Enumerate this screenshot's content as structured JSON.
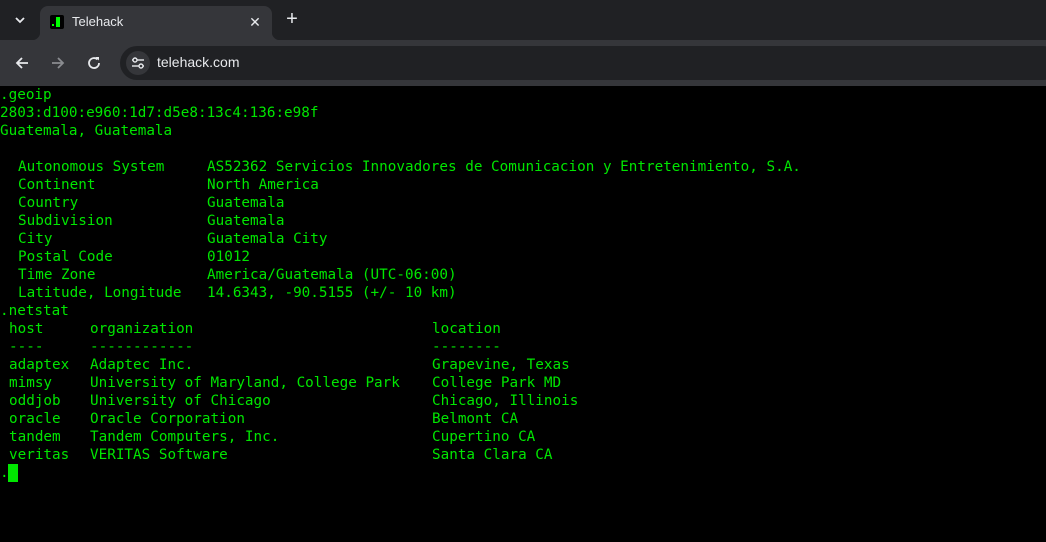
{
  "browser": {
    "tab_title": "Telehack",
    "tab_close": "✕",
    "new_tab": "+",
    "url": "telehack.com"
  },
  "terminal": {
    "geoip_cmd": ".geoip",
    "ip_address": "2803:d100:e960:1d7:d5e8:13c4:136:e98f",
    "place": "Guatemala, Guatemala",
    "geo_fields": [
      {
        "label": "Autonomous System",
        "value": "AS52362 Servicios Innovadores de Comunicacion y Entretenimiento, S.A."
      },
      {
        "label": "Continent",
        "value": "North America"
      },
      {
        "label": "Country",
        "value": "Guatemala"
      },
      {
        "label": "Subdivision",
        "value": "Guatemala"
      },
      {
        "label": "City",
        "value": "Guatemala City"
      },
      {
        "label": "Postal Code",
        "value": "01012"
      },
      {
        "label": "Time Zone",
        "value": "America/Guatemala (UTC-06:00)"
      },
      {
        "label": "Latitude, Longitude",
        "value": "14.6343, -90.5155 (+/- 10 km)"
      }
    ],
    "netstat_cmd": ".netstat",
    "netstat_headers": {
      "host": "host",
      "organization": "organization",
      "location": "location"
    },
    "netstat_rules": {
      "host": "----",
      "organization": "------------",
      "location": "--------"
    },
    "netstat_rows": [
      {
        "host": "adaptex",
        "organization": "Adaptec Inc.",
        "location": "Grapevine, Texas"
      },
      {
        "host": "mimsy",
        "organization": "University of Maryland, College Park",
        "location": "College Park MD"
      },
      {
        "host": "oddjob",
        "organization": "University of Chicago",
        "location": "Chicago, Illinois"
      },
      {
        "host": "oracle",
        "organization": "Oracle Corporation",
        "location": "Belmont CA"
      },
      {
        "host": "tandem",
        "organization": "Tandem Computers, Inc.",
        "location": "Cupertino CA"
      },
      {
        "host": "veritas",
        "organization": "VERITAS Software",
        "location": "Santa Clara CA"
      }
    ],
    "prompt": "."
  }
}
